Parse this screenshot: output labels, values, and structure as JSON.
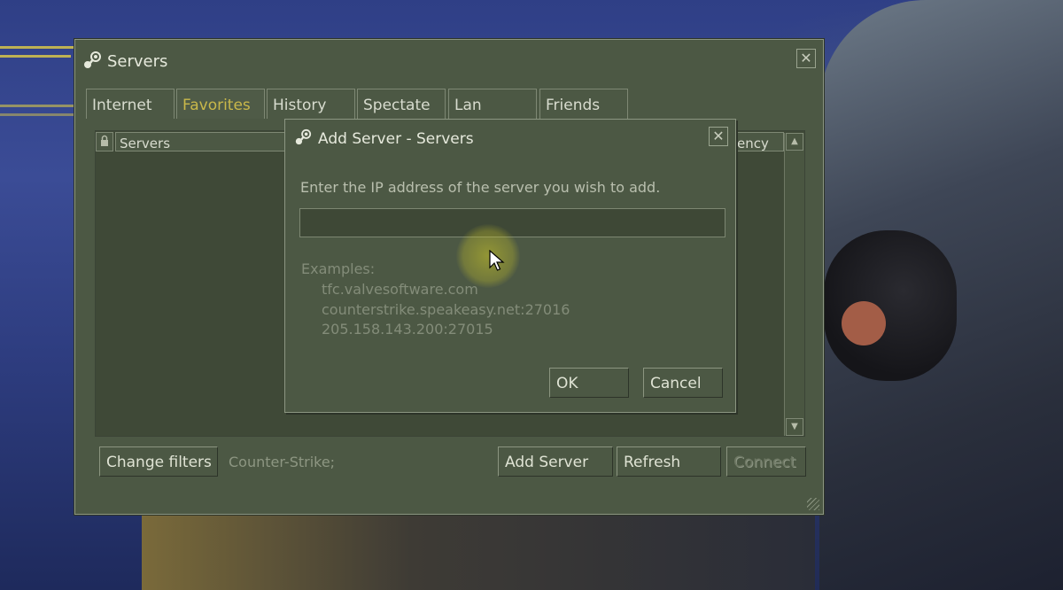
{
  "window": {
    "title": "Servers",
    "tabs": [
      {
        "label": "Internet",
        "active": false
      },
      {
        "label": "Favorites",
        "active": true
      },
      {
        "label": "History",
        "active": false
      },
      {
        "label": "Spectate",
        "active": false
      },
      {
        "label": "Lan",
        "active": false
      },
      {
        "label": "Friends",
        "active": false
      }
    ],
    "columns": {
      "servers": "Servers",
      "latency_partial": "ency"
    },
    "buttons": {
      "change_filters": "Change filters",
      "add_server": "Add Server",
      "refresh": "Refresh",
      "connect": "Connect"
    },
    "filter_text": "Counter-Strike;",
    "close_glyph": "✕"
  },
  "dialog": {
    "title": "Add Server - Servers",
    "prompt": "Enter the IP address of the server you wish to add.",
    "ip_value": "",
    "examples_label": "Examples:",
    "examples": [
      "tfc.valvesoftware.com",
      "counterstrike.speakeasy.net:27016",
      "205.158.143.200:27015"
    ],
    "ok": "OK",
    "cancel": "Cancel",
    "close_glyph": "✕"
  },
  "icons": {
    "steam": "steam-logo-icon",
    "lock": "lock-icon",
    "scroll_up": "scroll-up-arrow-icon",
    "scroll_down": "scroll-down-arrow-icon",
    "resize": "resize-grip-icon",
    "cursor": "mouse-cursor-icon"
  },
  "colors": {
    "window_bg": "#4c5844",
    "active_tab_text": "#c9b84a",
    "text": "#d8dccf",
    "muted_text": "#838c79",
    "cursor_halo": "#cdc828"
  }
}
